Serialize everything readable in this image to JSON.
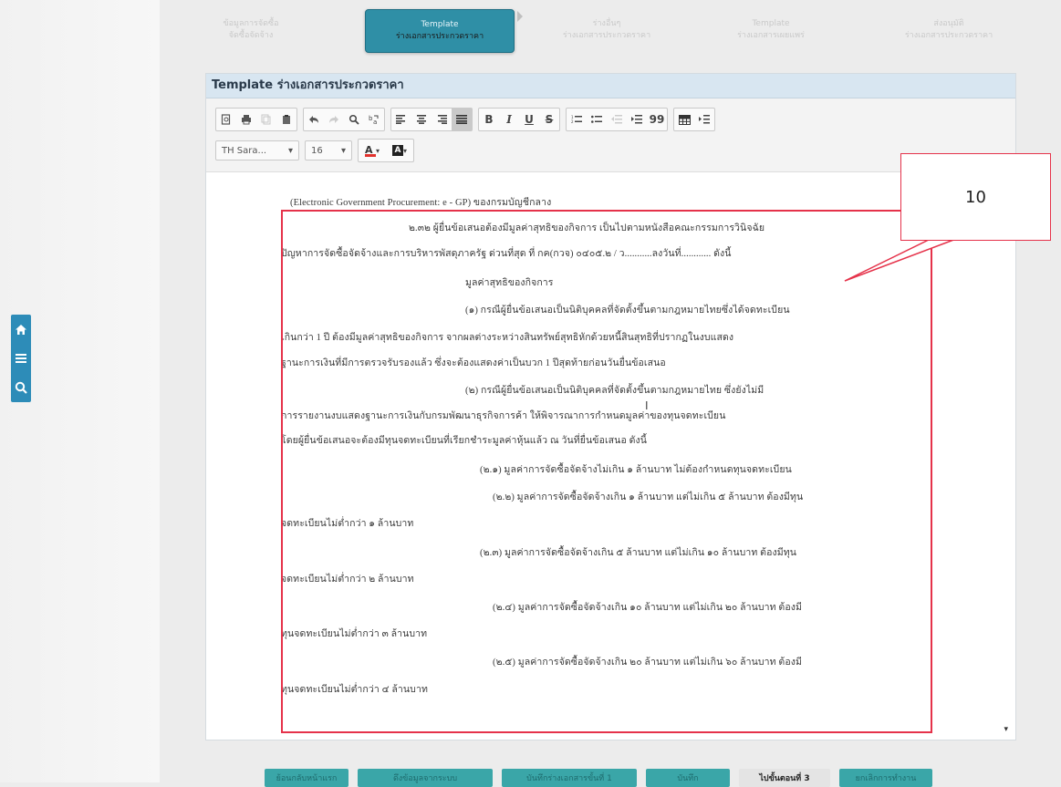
{
  "sidebar_quick": {
    "home_icon": "home-icon",
    "menu_icon": "menu-icon",
    "search_icon": "search-icon"
  },
  "wizard": {
    "steps": [
      {
        "l1": "ข้อมูลการจัดซื้อ",
        "l2": "จัดซื้อจัดจ้าง",
        "active": false
      },
      {
        "l1": "Template",
        "l2": "ร่างเอกสารประกวดราคา",
        "active": true
      },
      {
        "l1": "ร่างอื่นๆ",
        "l2": "ร่างเอกสารประกวดราคา",
        "active": false
      },
      {
        "l1": "Template",
        "l2": "ร่างเอกสารเผยแพร่",
        "active": false
      },
      {
        "l1": "ส่งอนุมัติ",
        "l2": "ร่างเอกสารประกวดราคา",
        "active": false
      }
    ]
  },
  "panel": {
    "title": "Template ร่างเอกสารประกวดราคา"
  },
  "toolbar": {
    "font_family": "TH Sara...",
    "font_size": "16",
    "text_color_label": "A",
    "bg_color_label": "A",
    "bold": "B",
    "italic": "I",
    "underline": "U",
    "strike": "S",
    "quote": "99",
    "text_color": "#e0312c",
    "bg_color": "#222222"
  },
  "document": {
    "lines": [
      {
        "text": "(Electronic Government Procurement: e - GP) ของกรมบัญชีกลาง"
      },
      {
        "text": "๒.๓๒     ผู้ยื่นข้อเสนอต้องมีมูลค่าสุทธิของกิจการ เป็นไปตามหนังสือคณะกรรมการวินิจฉัย"
      },
      {
        "text": "ปัญหาการจัดซื้อจัดจ้างและการบริหารพัสดุภาครัฐ ด่วนที่สุด ที่ กค(กวจ) ๐๔๐๕.๒ / ว...........ลงวันที่............ ดังนี้"
      },
      {
        "text": "มูลค่าสุทธิของกิจการ"
      },
      {
        "text": "(๑) กรณีผู้ยื่นข้อเสนอเป็นนิติบุคคลที่จัดตั้งขึ้นตามกฎหมายไทยซึ่งได้จดทะเบียน"
      },
      {
        "text": "เกินกว่า 1 ปี ต้องมีมูลค่าสุทธิของกิจการ จากผลต่างระหว่างสินทรัพย์สุทธิหักด้วยหนี้สินสุทธิที่ปรากฏในงบแสดง"
      },
      {
        "text": "ฐานะการเงินที่มีการตรวจรับรองแล้ว ซึ่งจะต้องแสดงค่าเป็นบวก 1 ปีสุดท้ายก่อนวันยื่นข้อเสนอ"
      },
      {
        "text": "(๒) กรณีผู้ยื่นข้อเสนอเป็นนิติบุคคลที่จัดตั้งขึ้นตามกฎหมายไทย ซึ่งยังไม่มี"
      },
      {
        "text": "การรายงานงบแสดงฐานะการเงินกับกรมพัฒนาธุรกิจการค้า ให้พิจารณาการกำหนดมูลค่าของทุนจดทะเบียน"
      },
      {
        "text": "โดยผู้ยื่นข้อเสนอจะต้องมีทุนจดทะเบียนที่เรียกชำระมูลค่าหุ้นแล้ว ณ วันที่ยื่นข้อเสนอ ดังนี้"
      },
      {
        "text": "(๒.๑)  มูลค่าการจัดซื้อจัดจ้างไม่เกิน ๑ ล้านบาท ไม่ต้องกำหนดทุนจดทะเบียน"
      },
      {
        "text": "(๒.๒)  มูลค่าการจัดซื้อจัดจ้างเกิน ๑ ล้านบาท แต่ไม่เกิน ๕ ล้านบาท ต้องมีทุน"
      },
      {
        "text": "จดทะเบียนไม่ต่ำกว่า ๑ ล้านบาท"
      },
      {
        "text": "(๒.๓)  มูลค่าการจัดซื้อจัดจ้างเกิน ๕ ล้านบาท แต่ไม่เกิน ๑๐ ล้านบาท ต้องมีทุน"
      },
      {
        "text": "จดทะเบียนไม่ต่ำกว่า ๒ ล้านบาท"
      },
      {
        "text": "(๒.๔)  มูลค่าการจัดซื้อจัดจ้างเกิน ๑๐ ล้านบาท แต่ไม่เกิน ๒๐ ล้านบาท ต้องมี"
      },
      {
        "text": "ทุนจดทะเบียนไม่ต่ำกว่า ๓ ล้านบาท"
      },
      {
        "text": "(๒.๕)  มูลค่าการจัดซื้อจัดจ้างเกิน ๒๐ ล้านบาท แต่ไม่เกิน ๖๐ ล้านบาท ต้องมี"
      },
      {
        "text": "ทุนจดทะเบียนไม่ต่ำกว่า ๔ ล้านบาท"
      }
    ]
  },
  "annotation": {
    "callout_number": "10",
    "color": "#e5324a"
  },
  "bottom_buttons": [
    {
      "label": "ย้อนกลับหน้าแรก"
    },
    {
      "label": "ดึงข้อมูลจากระบบ"
    },
    {
      "label": "บันทึกร่างเอกสารขั้นที่ 1"
    },
    {
      "label": "บันทึก"
    },
    {
      "label": "ไปขั้นตอนที่ 3"
    },
    {
      "label": "ยกเลิกการทำงาน"
    }
  ]
}
